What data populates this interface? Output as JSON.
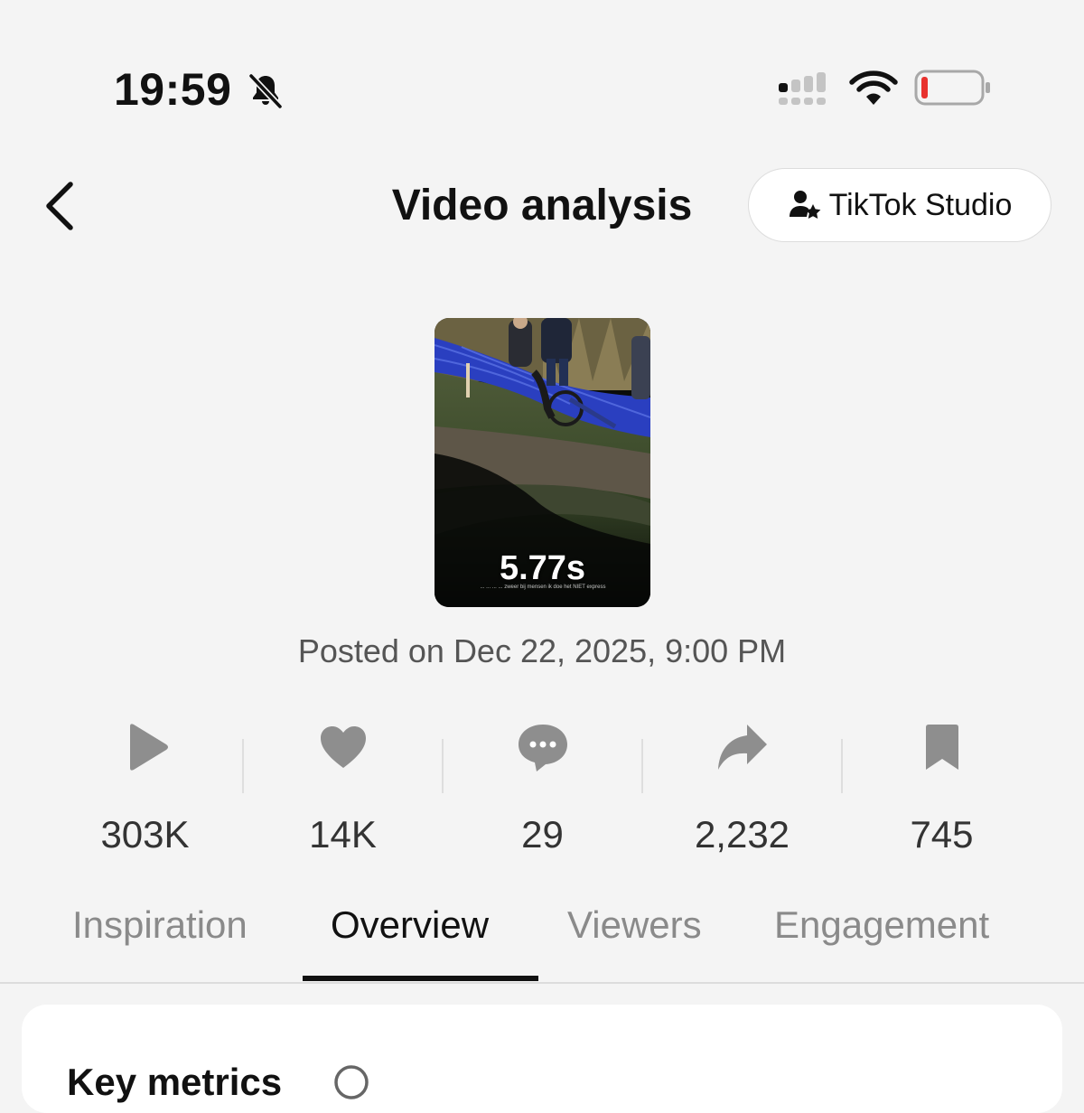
{
  "status_bar": {
    "time": "19:59",
    "icons": [
      "bell-slash-icon",
      "cellular-signal-icon",
      "wifi-icon",
      "battery-low-icon"
    ],
    "battery_color": "#e8322e"
  },
  "header": {
    "title": "Video analysis",
    "studio_button": "TikTok Studio"
  },
  "video": {
    "duration": "5.77s",
    "caption": "... ... ... ... zweer bij mensen ik doe het NIET express",
    "posted": "Posted on Dec 22, 2025, 9:00 PM"
  },
  "stats": [
    {
      "icon": "play-icon",
      "value": "303K"
    },
    {
      "icon": "heart-icon",
      "value": "14K"
    },
    {
      "icon": "comment-icon",
      "value": "29"
    },
    {
      "icon": "share-icon",
      "value": "2,232"
    },
    {
      "icon": "bookmark-icon",
      "value": "745"
    }
  ],
  "tabs": [
    {
      "label": "Inspiration",
      "active": false
    },
    {
      "label": "Overview",
      "active": true
    },
    {
      "label": "Viewers",
      "active": false
    },
    {
      "label": "Engagement",
      "active": false
    }
  ],
  "card": {
    "title": "Key metrics"
  },
  "colors": {
    "background": "#f4f4f4",
    "icon_gray": "#8e8e8e",
    "active_tab": "#111111"
  }
}
